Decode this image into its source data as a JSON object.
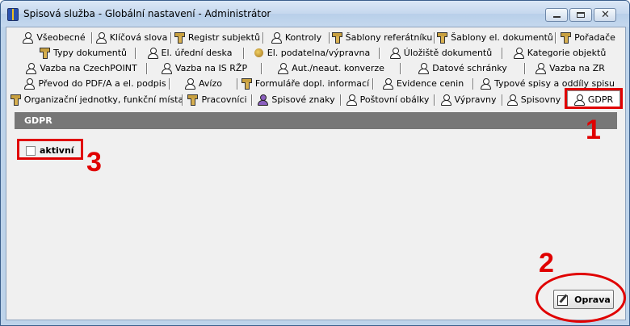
{
  "window": {
    "title": "Spisová služba - Globální nastavení - Administrátor"
  },
  "tab_rows": [
    [
      {
        "label": "Všeobecné",
        "icon": "person-icon"
      },
      {
        "label": "Klíčová slova",
        "icon": "person-icon"
      },
      {
        "label": "Registr subjektů",
        "icon": "pencil-icon"
      },
      {
        "label": "Kontroly",
        "icon": "person-icon"
      },
      {
        "label": "Šablony referátníku",
        "icon": "pencil-icon"
      },
      {
        "label": "Šablony el. dokumentů",
        "icon": "pencil-icon"
      },
      {
        "label": "Pořadače",
        "icon": "pencil-icon"
      }
    ],
    [
      {
        "label": "Typy dokumentů",
        "icon": "pencil-icon"
      },
      {
        "label": "El. úřední deska",
        "icon": "person-icon"
      },
      {
        "label": "El. podatelna/výpravna",
        "icon": "group-icon"
      },
      {
        "label": "Úložiště dokumentů",
        "icon": "person-icon"
      },
      {
        "label": "Kategorie objektů",
        "icon": "person-icon"
      }
    ],
    [
      {
        "label": "Vazba na CzechPOINT",
        "icon": "person-icon"
      },
      {
        "label": "Vazba na IS RŽP",
        "icon": "person-icon"
      },
      {
        "label": "Aut./neaut. konverze",
        "icon": "person-icon"
      },
      {
        "label": "Datové schránky",
        "icon": "person-icon"
      },
      {
        "label": "Vazba na ZR",
        "icon": "person-icon"
      }
    ],
    [
      {
        "label": "Převod do PDF/A a el. podpis",
        "icon": "person-icon"
      },
      {
        "label": "Avízo",
        "icon": "person-icon"
      },
      {
        "label": "Formuláře dopl. informací",
        "icon": "pencil-icon"
      },
      {
        "label": "Evidence cenin",
        "icon": "person-icon"
      },
      {
        "label": "Typové spisy a oddíly spisu",
        "icon": "person-icon"
      }
    ],
    [
      {
        "label": "Organizační jednotky, funkční místa",
        "icon": "pencil-icon"
      },
      {
        "label": "Pracovníci",
        "icon": "pencil-icon"
      },
      {
        "label": "Spisové znaky",
        "icon": "person-icon-purple"
      },
      {
        "label": "Poštovní obálky",
        "icon": "person-icon"
      },
      {
        "label": "Výpravny",
        "icon": "person-icon"
      },
      {
        "label": "Spisovny",
        "icon": "person-icon"
      },
      {
        "label": "GDPR",
        "icon": "person-icon",
        "active": true
      }
    ]
  ],
  "section": {
    "title": "GDPR"
  },
  "checkbox": {
    "label": "aktivní",
    "checked": false
  },
  "button": {
    "label": "Oprava",
    "icon": "edit-icon"
  },
  "callouts": [
    "1",
    "2",
    "3"
  ],
  "colors": {
    "callout": "#e00000",
    "section_header": "#777777"
  }
}
